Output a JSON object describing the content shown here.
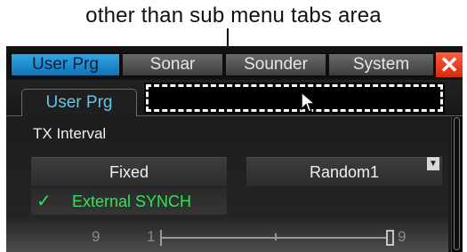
{
  "callout": {
    "text": "other than sub menu tabs area"
  },
  "tabs": [
    {
      "label": "User Prg",
      "active": true
    },
    {
      "label": "Sonar",
      "active": false
    },
    {
      "label": "Sounder",
      "active": false
    },
    {
      "label": "System",
      "active": false
    }
  ],
  "close_label": "✕",
  "subtab": {
    "label": "User Prg"
  },
  "content": {
    "section_label": "TX Interval",
    "fixed_label": "Fixed",
    "random_label": "Random1",
    "dropdown_arrow": "▼",
    "sync": {
      "check": "✓",
      "label": "External SYNCH"
    },
    "slider": {
      "left_value": "9",
      "min": "1",
      "max": "9"
    }
  },
  "colors": {
    "active_tab": "#1a86cf",
    "close": "#e8401f",
    "subtab_text": "#63c5ea",
    "sync_text": "#37e05b"
  }
}
